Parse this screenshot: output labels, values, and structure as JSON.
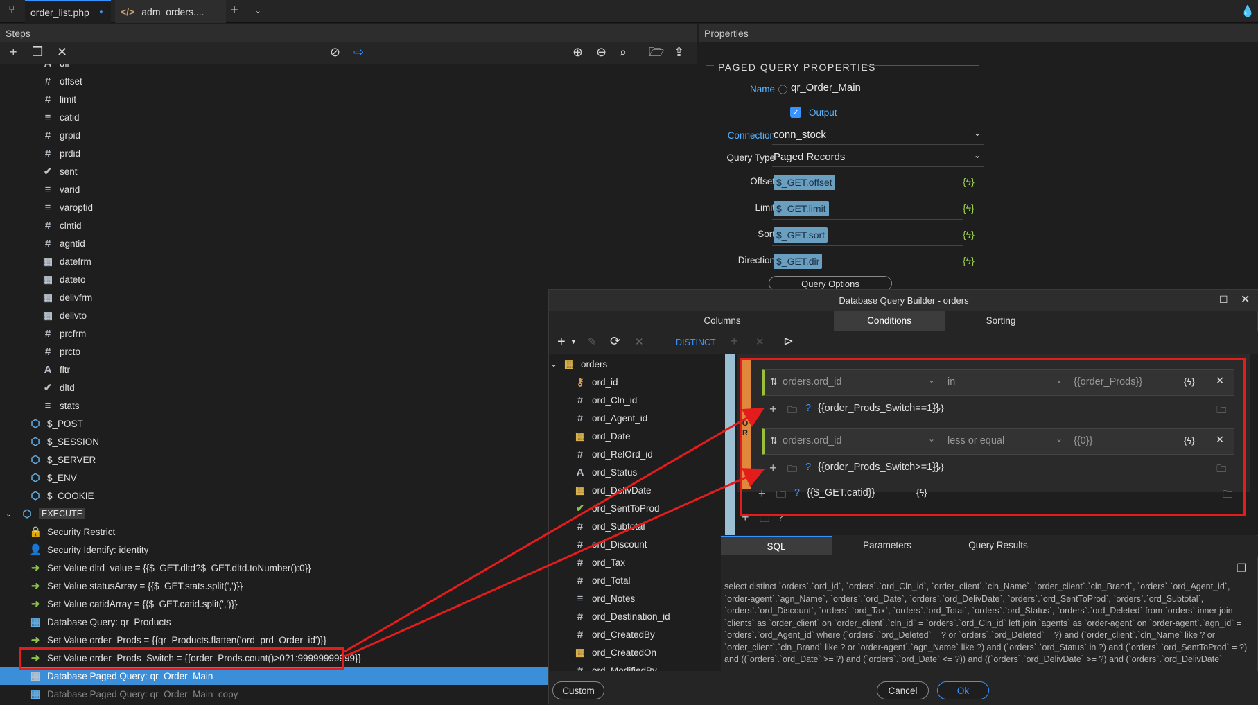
{
  "tabs": [
    {
      "label": "order_list.php"
    },
    {
      "label": "adm_orders...."
    }
  ],
  "steps_panel": {
    "title": "Steps"
  },
  "properties_panel": {
    "title": "Properties",
    "section": "PAGED QUERY PROPERTIES",
    "name_label": "Name",
    "name_value": "qr_Order_Main",
    "output_label": "Output",
    "connection_label": "Connection",
    "connection_value": "conn_stock",
    "query_type_label": "Query Type",
    "query_type_value": "Paged Records",
    "offset_label": "Offset",
    "offset_value": "$_GET.offset",
    "limit_label": "Limit",
    "limit_value": "$_GET.limit",
    "sort_label": "Sort",
    "sort_value": "$_GET.sort",
    "direction_label": "Direction",
    "direction_value": "$_GET.dir",
    "query_options": "Query Options",
    "bolt": "{ϟ}"
  },
  "step_rows": [
    {
      "icon": "A",
      "label": "dir"
    },
    {
      "icon": "#",
      "label": "offset"
    },
    {
      "icon": "#",
      "label": "limit"
    },
    {
      "icon": "≡",
      "label": "catid"
    },
    {
      "icon": "#",
      "label": "grpid"
    },
    {
      "icon": "#",
      "label": "prdid"
    },
    {
      "icon": "✔",
      "label": "sent"
    },
    {
      "icon": "≡",
      "label": "varid"
    },
    {
      "icon": "≡",
      "label": "varoptid"
    },
    {
      "icon": "#",
      "label": "clntid"
    },
    {
      "icon": "#",
      "label": "agntid"
    },
    {
      "icon": "▦",
      "label": "datefrm"
    },
    {
      "icon": "▦",
      "label": "dateto"
    },
    {
      "icon": "▦",
      "label": "delivfrm"
    },
    {
      "icon": "▦",
      "label": "delivto"
    },
    {
      "icon": "#",
      "label": "prcfrm"
    },
    {
      "icon": "#",
      "label": "prcto"
    },
    {
      "icon": "A",
      "label": "fltr"
    },
    {
      "icon": "✔",
      "label": "dltd"
    },
    {
      "icon": "≡",
      "label": "stats"
    }
  ],
  "global_rows": [
    {
      "label": "$_POST"
    },
    {
      "label": "$_SESSION"
    },
    {
      "label": "$_SERVER"
    },
    {
      "label": "$_ENV"
    },
    {
      "label": "$_COOKIE"
    }
  ],
  "execute_label": "EXECUTE",
  "exec_rows": [
    {
      "label": "Security Restrict"
    },
    {
      "label": "Security Identify: identity"
    },
    {
      "label": "Set Value dltd_value = {{$_GET.dltd?$_GET.dltd.toNumber():0}}"
    },
    {
      "label": "Set Value statusArray = {{$_GET.stats.split(',')}}"
    },
    {
      "label": "Set Value catidArray = {{$_GET.catid.split(',')}}"
    },
    {
      "label": "Database Query: qr_Products"
    },
    {
      "label": "Set Value order_Prods = {{qr_Products.flatten('ord_prd_Order_id')}}"
    },
    {
      "label": "Set Value order_Prods_Switch = {{order_Prods.count()>0?1:99999999999}}"
    },
    {
      "label": "Database Paged Query: qr_Order_Main"
    },
    {
      "label": "Database Paged Query: qr_Order_Main_copy"
    }
  ],
  "dialog": {
    "title": "Database Query Builder - orders",
    "tabs": [
      {
        "label": "Columns"
      },
      {
        "label": "Conditions"
      },
      {
        "label": "Sorting"
      }
    ],
    "distinct": "DISTINCT",
    "table": "orders",
    "custom": "Custom",
    "cancel": "Cancel",
    "ok": "Ok",
    "bottom_tabs": [
      {
        "label": "SQL"
      },
      {
        "label": "Parameters"
      },
      {
        "label": "Query Results"
      }
    ]
  },
  "columns": [
    {
      "icon": "key",
      "label": "ord_id"
    },
    {
      "icon": "#",
      "label": "ord_Cln_id"
    },
    {
      "icon": "#",
      "label": "ord_Agent_id"
    },
    {
      "icon": "▦",
      "label": "ord_Date"
    },
    {
      "icon": "#",
      "label": "ord_RelOrd_id"
    },
    {
      "icon": "A",
      "label": "ord_Status"
    },
    {
      "icon": "▦",
      "label": "ord_DelivDate"
    },
    {
      "icon": "✔",
      "label": "ord_SentToProd"
    },
    {
      "icon": "#",
      "label": "ord_Subtotal"
    },
    {
      "icon": "#",
      "label": "ord_Discount"
    },
    {
      "icon": "#",
      "label": "ord_Tax"
    },
    {
      "icon": "#",
      "label": "ord_Total"
    },
    {
      "icon": "≡",
      "label": "ord_Notes"
    },
    {
      "icon": "#",
      "label": "ord_Destination_id"
    },
    {
      "icon": "#",
      "label": "ord_CreatedBy"
    },
    {
      "icon": "▦",
      "label": "ord_CreatedOn"
    },
    {
      "icon": "#",
      "label": "ord_ModifiedBy"
    }
  ],
  "conditions": {
    "group_op": "O R",
    "c1": {
      "field": "orders.ord_id",
      "op": "in",
      "value": "{{order_Prods}}",
      "cond": "{{order_Prods_Switch==1}}"
    },
    "c2": {
      "field": "orders.ord_id",
      "op": "less or equal",
      "value": "{{0}}",
      "cond": "{{order_Prods_Switch>=1}}"
    },
    "group_cond": "{{$_GET.catid}}"
  },
  "sql": "select distinct `orders`.`ord_id`, `orders`.`ord_Cln_id`, `order_client`.`cln_Name`, `order_client`.`cln_Brand`, `orders`.`ord_Agent_id`, `order-agent`.`agn_Name`, `orders`.`ord_Date`, `orders`.`ord_DelivDate`, `orders`.`ord_SentToProd`, `orders`.`ord_Subtotal`, `orders`.`ord_Discount`, `orders`.`ord_Tax`, `orders`.`ord_Total`, `orders`.`ord_Status`, `orders`.`ord_Deleted` from `orders` inner join `clients` as `order_client` on `order_client`.`cln_id` = `orders`.`ord_Cln_id` left join `agents` as `order-agent` on `order-agent`.`agn_id` = `orders`.`ord_Agent_id` where (`orders`.`ord_Deleted` = ? or `orders`.`ord_Deleted` = ?) and (`order_client`.`cln_Name` like ? or `order_client`.`cln_Brand` like ? or `order-agent`.`agn_Name` like ?) and (`orders`.`ord_Status` in ?) and (`orders`.`ord_SentToProd` = ?) and ((`orders`.`ord_Date` >= ?) and (`orders`.`ord_Date` <= ?)) and ((`orders`.`ord_DelivDate` >= ?) and (`orders`.`ord_DelivDate`"
}
